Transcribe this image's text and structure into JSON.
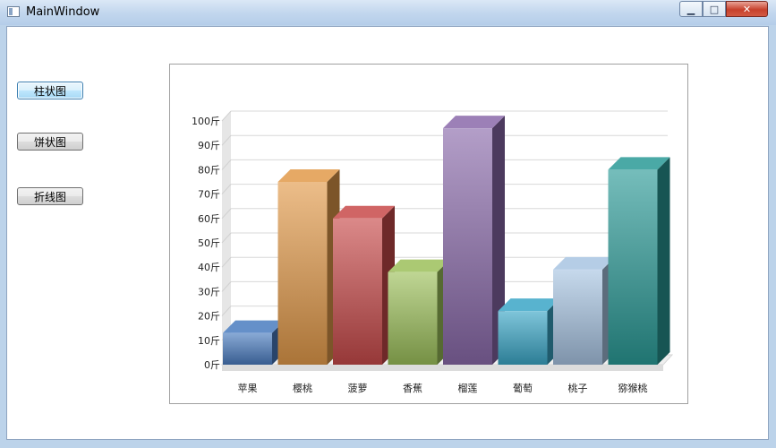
{
  "window": {
    "title": "MainWindow"
  },
  "sidebar": {
    "buttons": [
      {
        "label": "柱状图"
      },
      {
        "label": "饼状图"
      },
      {
        "label": "折线图"
      }
    ]
  },
  "chart_data": {
    "type": "bar",
    "categories": [
      "苹果",
      "樱桃",
      "菠萝",
      "香蕉",
      "榴莲",
      "葡萄",
      "桃子",
      "猕猴桃"
    ],
    "values": [
      13,
      75,
      60,
      38,
      97,
      22,
      39,
      80
    ],
    "y_ticks": [
      "0斤",
      "10斤",
      "20斤",
      "30斤",
      "40斤",
      "50斤",
      "60斤",
      "70斤",
      "80斤",
      "90斤",
      "100斤"
    ],
    "ylim": [
      0,
      100
    ],
    "grid": true,
    "style": "3d",
    "colors": [
      "#4a7cc0",
      "#e29a4a",
      "#c84a4a",
      "#9cc05a",
      "#8a6aaa",
      "#3aa6c6",
      "#a8c4e2",
      "#2a9a96"
    ]
  }
}
